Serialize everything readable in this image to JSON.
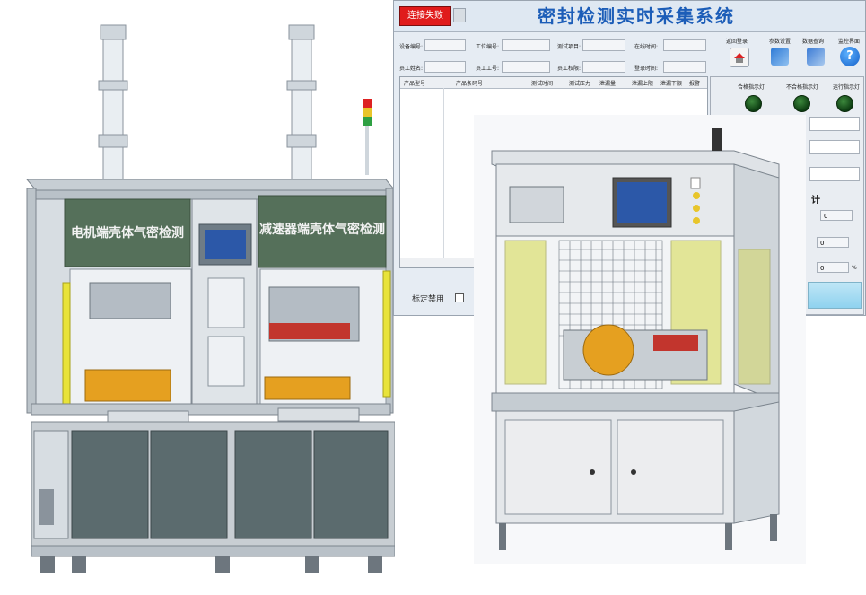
{
  "software": {
    "title": "密封检测实时采集系统",
    "connect_button": "连接失败",
    "fields": {
      "device_no": "设备编号:",
      "station_no": "工位编号:",
      "test_item": "测试项目:",
      "online_time": "在线时间:",
      "employee_name": "员工姓名:",
      "employee_id": "员工工号:",
      "employee_perm": "员工权限:",
      "login_time": "登录时间:"
    },
    "toolbar": {
      "back_login": "返回登录",
      "param_settings": "参数设置",
      "data_query": "数据查询",
      "monitor_ui": "监控界面"
    },
    "table_headers": [
      "产品型号",
      "产品条码号",
      "测试时间",
      "测试压力",
      "泄漏量",
      "泄漏上限",
      "泄漏下限",
      "报警"
    ],
    "indicators": {
      "pass": "合格指示灯",
      "fail": "不合格指示灯",
      "run": "运行指示灯"
    },
    "stats_values": [
      "0",
      "0",
      "0"
    ],
    "percent": "%",
    "calibration_disable": "标定禁用",
    "partial_char": "计"
  },
  "machine_left": {
    "panel_left": "电机端壳体气密检测",
    "panel_right": "减速器端壳体气密检测"
  },
  "colors": {
    "panel_green": "#55705a",
    "cabinet": "#5b6b6e",
    "safety_yellow": "#e8e33a"
  }
}
